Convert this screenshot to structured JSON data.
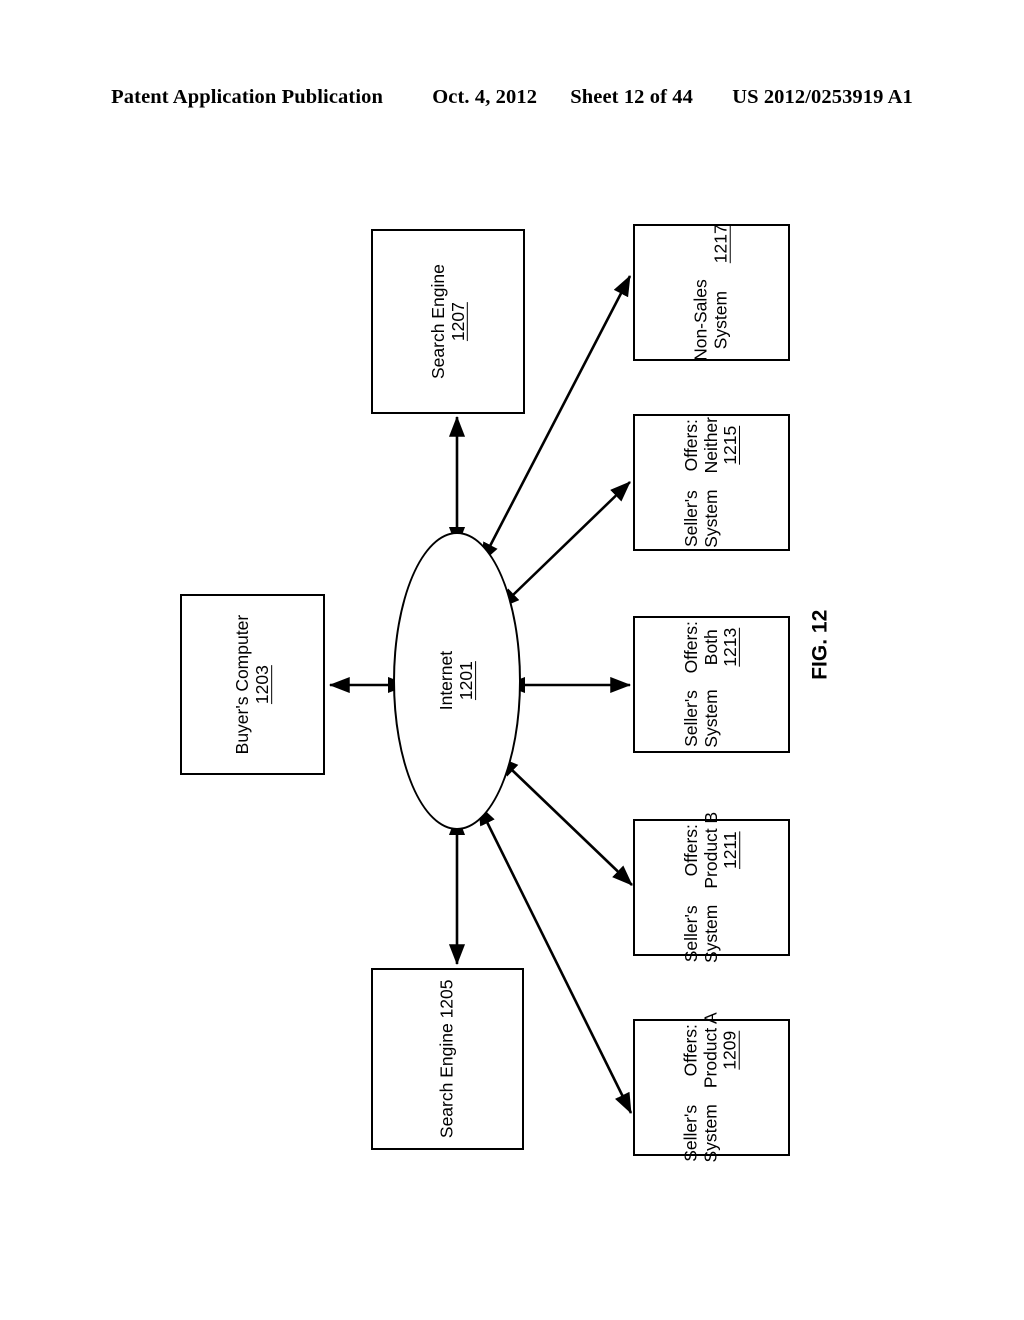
{
  "header": {
    "publication": "Patent Application Publication",
    "date": "Oct. 4, 2012",
    "sheet": "Sheet 12 of 44",
    "pub_number": "US 2012/0253919 A1"
  },
  "figure": {
    "caption": "FIG. 12",
    "hub": {
      "label": "Internet",
      "ref": "1201"
    },
    "nodes": [
      {
        "id": "search-engine-1207",
        "title": "Search Engine",
        "ref": "1207",
        "detail_label": "",
        "detail_value": ""
      },
      {
        "id": "buyers-computer-1203",
        "title": "Buyer's Computer",
        "ref": "1203",
        "detail_label": "",
        "detail_value": ""
      },
      {
        "id": "search-engine-1205",
        "title": "Search Engine 1205",
        "ref": "1205",
        "detail_label": "",
        "detail_value": ""
      },
      {
        "id": "non-sales-system-1217",
        "title_line1": "Non-Sales",
        "title_line2": "System",
        "ref": "1217",
        "detail_label": "",
        "detail_value": ""
      },
      {
        "id": "sellers-system-1215",
        "title_line1": "Seller's",
        "title_line2": "System",
        "detail_label": "Offers:",
        "detail_value": "Neither",
        "ref": "1215"
      },
      {
        "id": "sellers-system-1213",
        "title_line1": "Seller's",
        "title_line2": "System",
        "detail_label": "Offers:",
        "detail_value": "Both",
        "ref": "1213"
      },
      {
        "id": "sellers-system-1211",
        "title_line1": "Seller's",
        "title_line2": "System",
        "detail_label": "Offers:",
        "detail_value": "Product B",
        "ref": "1211"
      },
      {
        "id": "sellers-system-1209",
        "title_line1": "Seller's",
        "title_line2": "System",
        "detail_label": "Offers:",
        "detail_value": "Product A",
        "ref": "1209"
      }
    ],
    "connections": [
      {
        "from": "1201",
        "to": "1207",
        "style": "double-headed"
      },
      {
        "from": "1201",
        "to": "1203",
        "style": "double-headed"
      },
      {
        "from": "1201",
        "to": "1205",
        "style": "double-headed"
      },
      {
        "from": "1201",
        "to": "1217",
        "style": "double-headed"
      },
      {
        "from": "1201",
        "to": "1215",
        "style": "double-headed"
      },
      {
        "from": "1201",
        "to": "1213",
        "style": "double-headed"
      },
      {
        "from": "1201",
        "to": "1211",
        "style": "double-headed"
      },
      {
        "from": "1201",
        "to": "1209",
        "style": "double-headed"
      }
    ]
  },
  "colors": {
    "ink": "#000000",
    "paper": "#ffffff"
  }
}
